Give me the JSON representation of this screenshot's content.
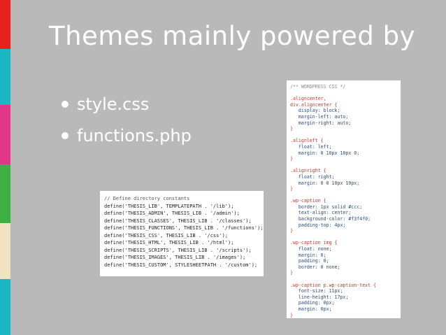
{
  "stripes": [
    {
      "color": "#e8211c",
      "h": 70
    },
    {
      "color": "#1bb8c4",
      "h": 80
    },
    {
      "color": "#e0378a",
      "h": 85
    },
    {
      "color": "#3cb043",
      "h": 84
    },
    {
      "color": "#f1e3c2",
      "h": 80
    },
    {
      "color": "#1bb8c4",
      "h": 80
    }
  ],
  "title": "Themes mainly powered by",
  "bullets": [
    "style.css",
    "functions.php"
  ],
  "php_code": [
    "// Define directory constants",
    "define('THESIS_LIB', TEMPLATEPATH . '/lib');",
    "define('THESIS_ADMIN', THESIS_LIB . '/admin');",
    "define('THESIS_CLASSES', THESIS_LIB . '/classes');",
    "define('THESIS_FUNCTIONS', THESIS_LIB . '/functions');",
    "define('THESIS_CSS', THESIS_LIB . '/css');",
    "define('THESIS_HTML', THESIS_LIB . '/html');",
    "define('THESIS_SCRIPTS', THESIS_LIB . '/scripts');",
    "define('THESIS_IMAGES', THESIS_LIB . '/images');",
    "define('THESIS_CUSTOM', STYLESHEETPATH . '/custom');"
  ],
  "css_code": [
    "/** WORDPRESS CSS */",
    "",
    ".aligncenter,",
    "div.aligncenter {",
    "   display: block;",
    "   margin-left: auto;",
    "   margin-right: auto;",
    "}",
    "",
    ".alignleft {",
    "   float: left;",
    "   margin: 0 10px 10px 0;",
    "}",
    "",
    ".alignright {",
    "   float: right;",
    "   margin: 0 0 10px 10px;",
    "}",
    "",
    ".wp-caption {",
    "   border: 1px solid #ccc;",
    "   text-align: center;",
    "   background-color: #f3f4f0;",
    "   padding-top: 4px;",
    "}",
    "",
    ".wp-caption img {",
    "   float: none;",
    "   margin: 0;",
    "   padding: 0;",
    "   border: 0 none;",
    "}",
    "",
    ".wp-caption p.wp-caption-text {",
    "   font-size: 11px;",
    "   line-height: 17px;",
    "   padding: 0px;",
    "   margin: 0px;",
    "}"
  ]
}
